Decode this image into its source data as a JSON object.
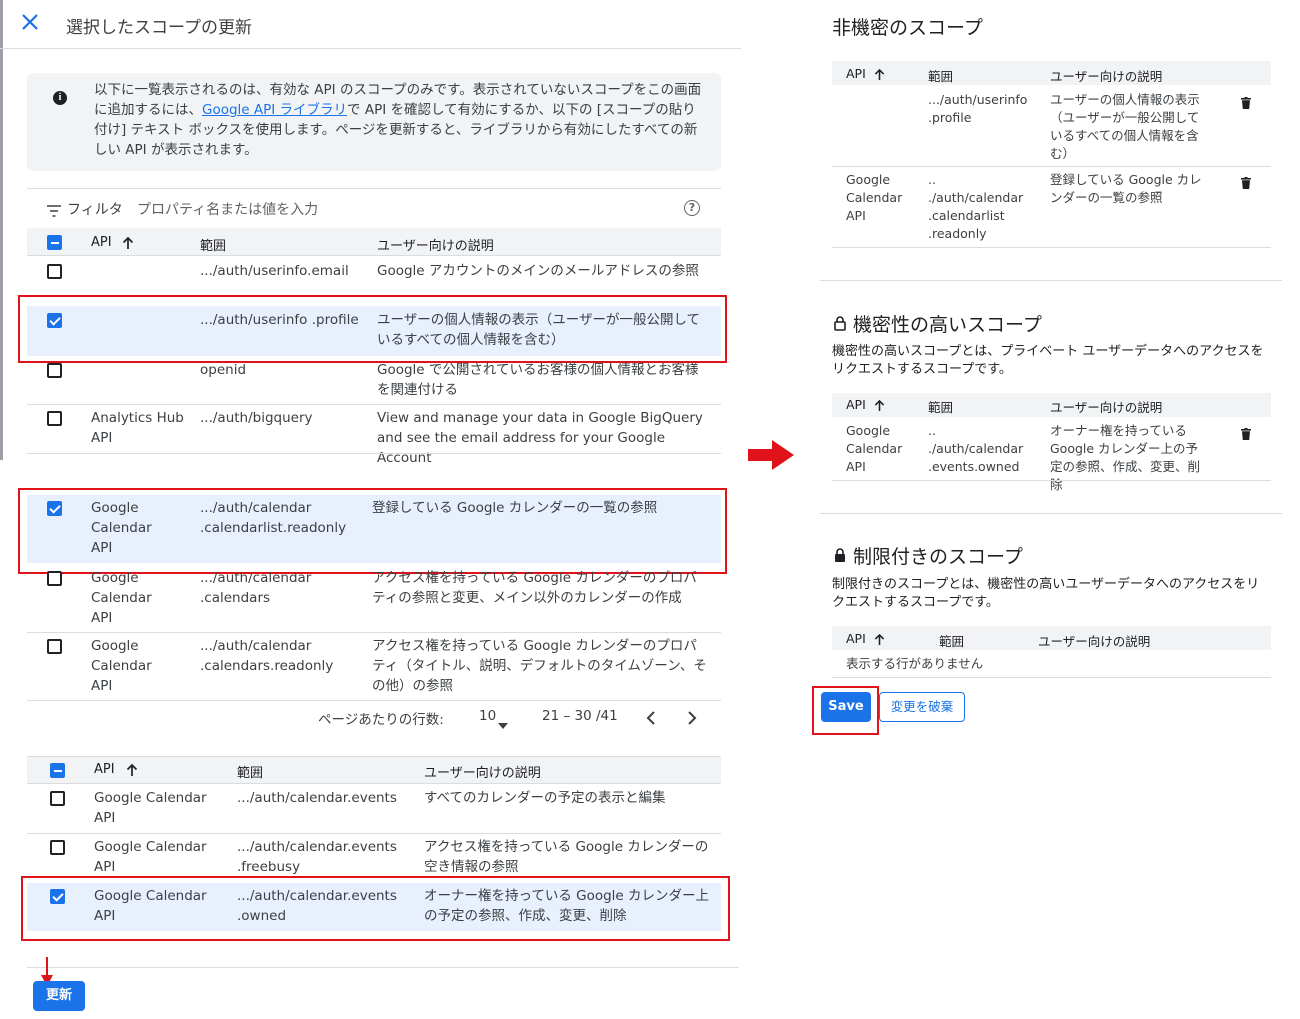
{
  "dialog": {
    "title": "選択したスコープの更新",
    "info_part1": "以下に一覧表示されるのは、有効な API のスコープのみです。表示されていないスコープをこの画面に追加するには、",
    "info_link": "Google API ライブラリ",
    "info_part2": "で API を確認して有効にするか、以下の [スコープの貼り付け] テキスト ボックスを使用します。ページを更新すると、ライブラリから有効にしたすべての新しい API が表示されます。",
    "filter_label": "フィルタ",
    "filter_placeholder": "プロパティ名または値を入力",
    "columns": {
      "api": "API",
      "scope": "範囲",
      "desc": "ユーザー向けの説明"
    },
    "rows": [
      {
        "api": "",
        "scope": ".../auth/userinfo.email",
        "desc": "Google アカウントのメインのメールアドレスの参照",
        "checked": false
      },
      {
        "api": "",
        "scope": ".../auth/userinfo .profile",
        "desc": "ユーザーの個人情報の表示（ユーザーが一般公開しているすべての個人情報を含む）",
        "checked": true
      },
      {
        "api": "",
        "scope": "openid",
        "desc": "Google で公開されているお客様の個人情報とお客様を関連付ける",
        "checked": false
      },
      {
        "api": "Analytics Hub API",
        "scope": ".../auth/bigquery",
        "desc": "View and manage your data in Google BigQuery and see the email address for your Google Account",
        "checked": false
      },
      {
        "api": "Google Calendar API",
        "scope": ".../auth/calendar .calendarlist.readonly",
        "desc": "登録している Google カレンダーの一覧の参照",
        "checked": true
      },
      {
        "api": "Google Calendar API",
        "scope": ".../auth/calendar .calendars",
        "desc": "アクセス権を持っている Google カレンダーのプロパティの参照と変更、メイン以外のカレンダーの作成",
        "checked": false
      },
      {
        "api": "Google Calendar API",
        "scope": ".../auth/calendar .calendars.readonly",
        "desc": "アクセス権を持っている Google カレンダーのプロパティ（タイトル、説明、デフォルトのタイムゾーン、その他）の参照",
        "checked": false
      }
    ],
    "pager": {
      "rows_label": "ページあたりの行数:",
      "rows_value": "10",
      "range": "21 – 30 /41"
    },
    "rows2": [
      {
        "api": "Google Calendar API",
        "scope": ".../auth/calendar.events",
        "desc": "すべてのカレンダーの予定の表示と編集",
        "checked": false
      },
      {
        "api": "Google Calendar API",
        "scope": ".../auth/calendar.events .freebusy",
        "desc": "アクセス権を持っている Google カレンダーの空き情報の参照",
        "checked": false
      },
      {
        "api": "Google Calendar API",
        "scope": ".../auth/calendar.events .owned",
        "desc": "オーナー権を持っている Google カレンダー上の予定の参照、作成、変更、削除",
        "checked": true
      }
    ],
    "update_button": "更新"
  },
  "right": {
    "non_sensitive": {
      "title": "非機密のスコープ",
      "columns": {
        "api": "API",
        "scope": "範囲",
        "desc": "ユーザー向けの説明"
      },
      "rows": [
        {
          "api": "",
          "scope": ".../auth/userinfo .profile",
          "desc": "ユーザーの個人情報の表示（ユーザーが一般公開しているすべての個人情報を含む）"
        },
        {
          "api": "Google Calendar API",
          "scope": ".. ./auth/calendar .calendarlist .readonly",
          "desc": "登録している Google カレンダーの一覧の参照"
        }
      ]
    },
    "sensitive": {
      "title": "機密性の高いスコープ",
      "desc": "機密性の高いスコープとは、プライベート ユーザーデータへのアクセスをリクエストするスコープです。",
      "columns": {
        "api": "API",
        "scope": "範囲",
        "desc": "ユーザー向けの説明"
      },
      "rows": [
        {
          "api": "Google Calendar API",
          "scope": ".. ./auth/calendar .events.owned",
          "desc": "オーナー権を持っている Google カレンダー上の予定の参照、作成、変更、削除"
        }
      ]
    },
    "restricted": {
      "title": "制限付きのスコープ",
      "desc": "制限付きのスコープとは、機密性の高いユーザーデータへのアクセスをリクエストするスコープです。",
      "columns": {
        "api": "API",
        "scope": "範囲",
        "desc": "ユーザー向けの説明"
      },
      "empty": "表示する行がありません"
    },
    "save_button": "Save",
    "discard_button": "変更を破棄"
  },
  "colors": {
    "accent": "#1a73e8",
    "highlight": "#e0121a",
    "selected_row": "#e8f0fe"
  },
  "icons": [
    "close-icon",
    "info-icon",
    "filter-icon",
    "help-icon",
    "sort-arrow-icon",
    "dropdown-icon",
    "chevron-left-icon",
    "chevron-right-icon",
    "trash-icon",
    "lock-icon",
    "arrow-right-icon",
    "arrow-down-icon"
  ]
}
